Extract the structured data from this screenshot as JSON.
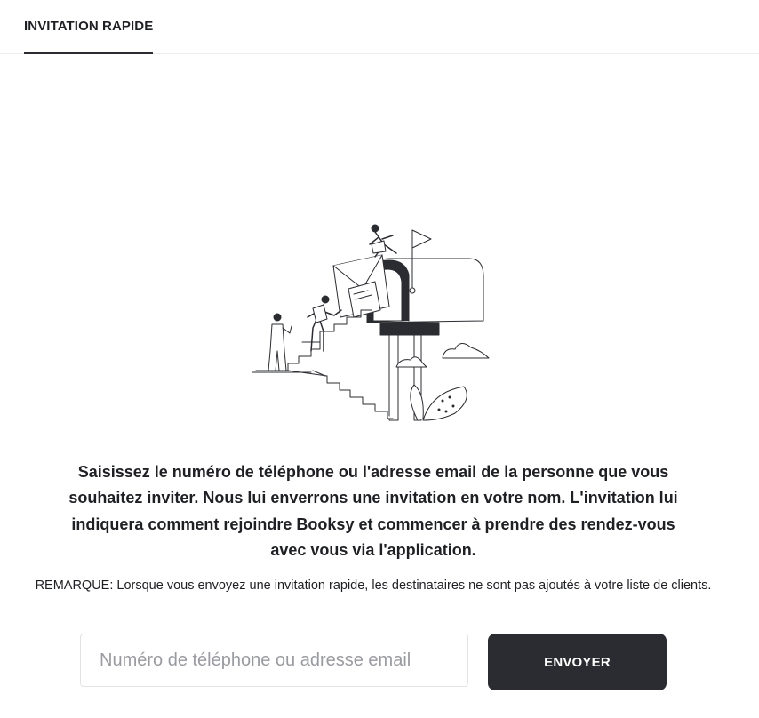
{
  "tabs": [
    {
      "label": "INVITATION RAPIDE",
      "active": true
    }
  ],
  "main": {
    "illustration": "mailbox-invitation-illustration",
    "description": "Saisissez le numéro de téléphone ou l'adresse email de la personne que vous souhaitez inviter. Nous lui enverrons une invitation en votre nom. L'invitation lui indiquera comment rejoindre Booksy et commencer à prendre des rendez-vous avec vous via l'application.",
    "note": "REMARQUE: Lorsque vous envoyez une invitation rapide, les destinataires ne sont pas ajoutés à votre liste de clients."
  },
  "form": {
    "input_value": "",
    "input_placeholder": "Numéro de téléphone ou adresse email",
    "send_label": "ENVOYER"
  },
  "colors": {
    "primary_dark": "#2b2c31",
    "text": "#1f2024",
    "border": "#e3e3e5",
    "placeholder": "#9a9ba0"
  }
}
